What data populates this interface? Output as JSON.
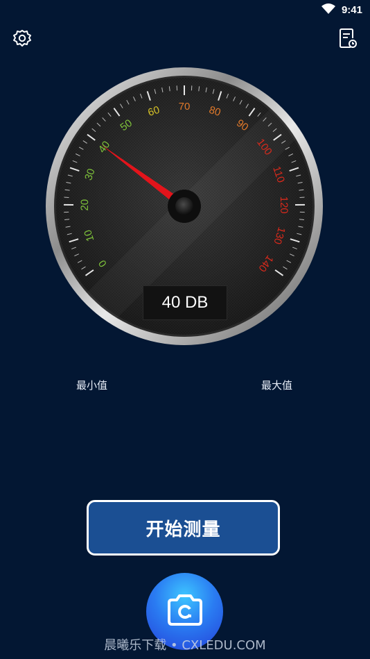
{
  "status_bar": {
    "time": "9:41",
    "wifi_icon": "wifi-icon"
  },
  "toolbar": {
    "settings_icon": "gear-icon",
    "history_icon": "history-log-icon"
  },
  "gauge": {
    "ticks": [
      "0",
      "10",
      "20",
      "30",
      "40",
      "50",
      "60",
      "70",
      "80",
      "90",
      "100",
      "110",
      "120",
      "130",
      "140"
    ],
    "min_value": 0,
    "max_value": 140,
    "needle_value": 40,
    "readout": "40 DB",
    "colors": {
      "green": "#7ec23a",
      "yellow": "#d6c227",
      "orange": "#e0792a",
      "red": "#d82a1c",
      "needle": "#e3141b"
    }
  },
  "labels": {
    "min": "最小值",
    "max": "最大值"
  },
  "start_button": {
    "label": "开始测量",
    "color": "#1b4f93"
  },
  "camera_button": {
    "icon": "camera-icon"
  },
  "watermark": "晨曦乐下载 • CXLEDU.COM"
}
